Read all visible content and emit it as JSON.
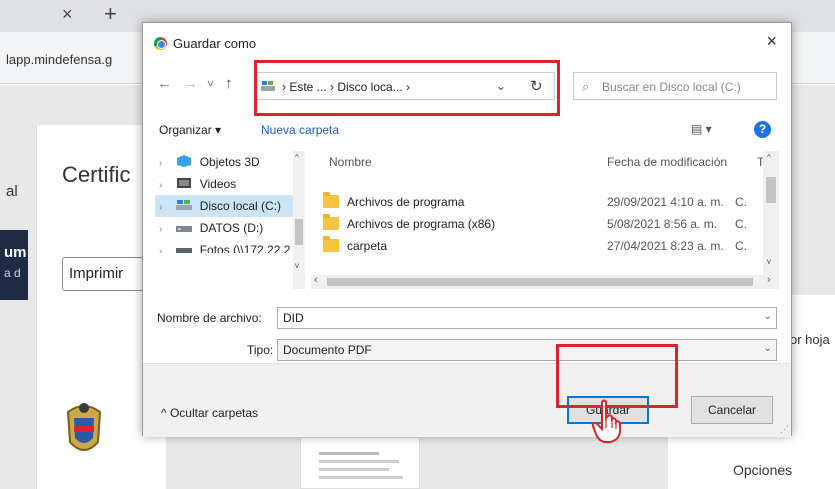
{
  "browser": {
    "tab_close": "×",
    "tab_new": "+",
    "url_fragment": "lapp.mindefensa.g"
  },
  "background_page": {
    "side_label": "al",
    "dark_banner_a": "um",
    "dark_banner_b": "a d",
    "heading": "Certific",
    "print_button": "Imprimir",
    "per_sheet": "or hoja",
    "options": "Opciones"
  },
  "dialog": {
    "title": "Guardar como",
    "close": "×",
    "nav": {
      "back": "←",
      "forward": "→",
      "recent": "˅",
      "up": "↑"
    },
    "address": {
      "path": "› Este ... › Disco loca... ›",
      "dropdown": "⌄",
      "refresh": "↻"
    },
    "search": {
      "placeholder": "Buscar en Disco local (C:)"
    },
    "toolbar": {
      "organize": "Organizar ▾",
      "new_folder": "Nueva carpeta",
      "view": "▤ ▾",
      "help": "?"
    },
    "tree": [
      {
        "label": "Objetos 3D",
        "icon": "3d-objects-icon"
      },
      {
        "label": "Videos",
        "icon": "videos-icon"
      },
      {
        "label": "Disco local (C:)",
        "icon": "local-disk-icon",
        "selected": true
      },
      {
        "label": "DATOS (D:)",
        "icon": "drive-icon"
      },
      {
        "label": "Fotos (\\\\172.22.2",
        "icon": "network-drive-icon"
      }
    ],
    "columns": {
      "name": "Nombre",
      "date": "Fecha de modificación",
      "type": "Ti"
    },
    "files": [
      {
        "name": "Archivos de programa",
        "date": "29/09/2021 4:10 a. m.",
        "type": "C."
      },
      {
        "name": "Archivos de programa (x86)",
        "date": "5/08/2021 8:56 a. m.",
        "type": "C."
      },
      {
        "name": "carpeta",
        "date": "27/04/2021 8:23 a. m.",
        "type": "C."
      }
    ],
    "filename": {
      "label": "Nombre de archivo:",
      "value": "DID"
    },
    "filetype": {
      "label": "Tipo:",
      "value": "Documento PDF"
    },
    "hide_folders": "^  Ocultar carpetas",
    "buttons": {
      "save": "Guardar",
      "cancel": "Cancelar"
    }
  },
  "colors": {
    "highlight": "#d8262a",
    "primary_border": "#0078d7",
    "selection": "#cce4f7"
  }
}
